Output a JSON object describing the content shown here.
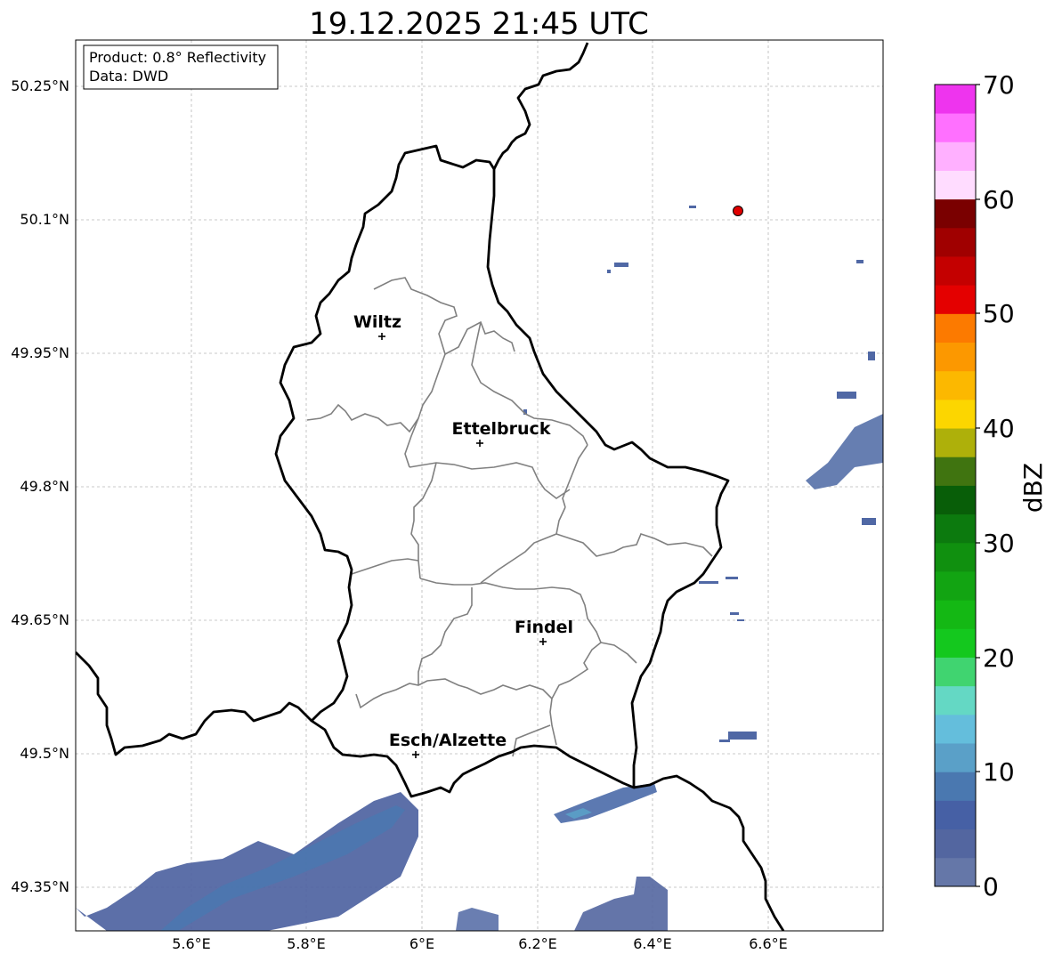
{
  "title": "19.12.2025 21:45 UTC",
  "info_box": {
    "product": "Product: 0.8° Reflectivity",
    "data": "Data: DWD"
  },
  "axes": {
    "x_ticks": [
      "5.6°E",
      "5.8°E",
      "6°E",
      "6.2°E",
      "6.4°E",
      "6.6°E"
    ],
    "y_ticks": [
      "50.25°N",
      "50.1°N",
      "49.95°N",
      "49.8°N",
      "49.65°N",
      "49.5°N",
      "49.35°N"
    ]
  },
  "cities": [
    {
      "name": "Wiltz"
    },
    {
      "name": "Ettelbruck"
    },
    {
      "name": "Findel"
    },
    {
      "name": "Esch/Alzette"
    }
  ],
  "radar_site_marker": {
    "color": "#e00000"
  },
  "colorbar": {
    "label": "dBZ",
    "ticks": [
      "0",
      "10",
      "20",
      "30",
      "40",
      "50",
      "60",
      "70"
    ],
    "colors": [
      "#6577a8",
      "#5366a0",
      "#4660a5",
      "#4a78b0",
      "#5aa0c8",
      "#64bedc",
      "#64d8c4",
      "#40d470",
      "#14c81e",
      "#14b814",
      "#12a412",
      "#10900f",
      "#0c7a0e",
      "#085e08",
      "#407410",
      "#aeb00a",
      "#fcd600",
      "#fcb800",
      "#fc9800",
      "#fc7a00",
      "#e40000",
      "#c40000",
      "#a00000",
      "#7a0000",
      "#ffdcff",
      "#ffb0ff",
      "#ff70ff",
      "#ee34ee"
    ]
  },
  "borders": {
    "country": "#000000",
    "canton": "#808080"
  }
}
